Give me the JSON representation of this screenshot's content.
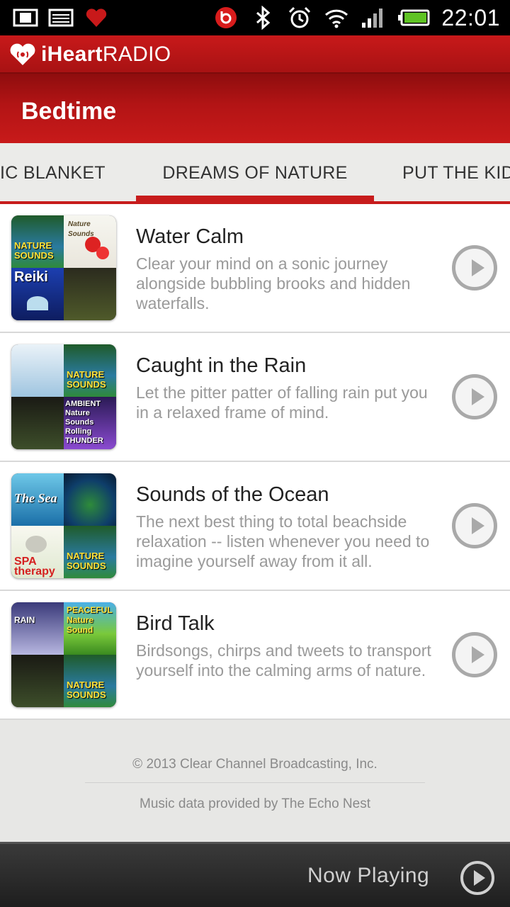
{
  "status_bar": {
    "time": "22:01",
    "left_icons": [
      "film-icon",
      "gallery-icon",
      "iheart-notification-icon"
    ],
    "right_icons": [
      "beats-icon",
      "bluetooth-icon",
      "alarm-icon",
      "wifi-icon",
      "signal-icon",
      "battery-icon"
    ]
  },
  "brand": {
    "name_bold": "iHeart",
    "name_light": "RADIO",
    "color": "#c8191a"
  },
  "page": {
    "title": "Bedtime"
  },
  "tabs": [
    {
      "label": "IC BLANKET"
    },
    {
      "label": "DREAMS OF NATURE",
      "selected": true
    },
    {
      "label": "PUT THE KID"
    }
  ],
  "stations": [
    {
      "title": "Water Calm",
      "description": "Clear your mind on a sonic journey alongside bubbling brooks and hidden waterfalls.",
      "thumb_labels": [
        "NATURE SOUNDS",
        "Nature Sounds",
        "Reiki",
        ""
      ]
    },
    {
      "title": "Caught in the Rain",
      "description": "Let the pitter patter of falling rain put you in a relaxed frame of mind.",
      "thumb_labels": [
        "",
        "NATURE SOUNDS",
        "",
        "AMBIENT Nature Sounds Rolling THUNDER"
      ]
    },
    {
      "title": "Sounds of the Ocean",
      "description": "The next best thing to total beachside relaxation -- listen whenever you need to imagine yourself away from it all.",
      "thumb_labels": [
        "The Sea",
        "",
        "SPA therapy",
        "NATURE SOUNDS"
      ]
    },
    {
      "title": "Bird Talk",
      "description": "Birdsongs, chirps and tweets to transport yourself into the calming arms of nature.",
      "thumb_labels": [
        "RAIN",
        "PEACEFUL Nature Sound",
        "",
        "NATURE SOUNDS"
      ]
    }
  ],
  "footer": {
    "copyright": "© 2013 Clear Channel Broadcasting, Inc.",
    "credit": "Music data provided by The Echo Nest"
  },
  "now_playing": {
    "label": "Now Playing"
  }
}
